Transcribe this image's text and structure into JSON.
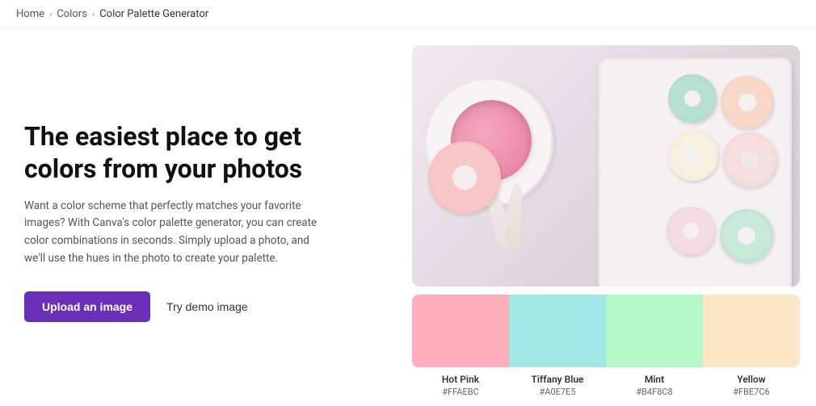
{
  "breadcrumb": {
    "home": "Home",
    "colors": "Colors",
    "current": "Color Palette Generator",
    "chevron": "›"
  },
  "hero": {
    "title": "The easiest place to get colors from your photos",
    "description": "Want a color scheme that perfectly matches your favorite images? With Canva's color palette generator, you can create color combinations in seconds. Simply upload a photo, and we'll use the hues in the photo to create your palette.",
    "upload_button": "Upload an image",
    "demo_button": "Try demo image"
  },
  "palette": {
    "colors": [
      {
        "name": "Hot Pink",
        "hex": "#FFAEBC",
        "css": "#FFAEBC"
      },
      {
        "name": "Tiffany Blue",
        "hex": "#A0E7E5",
        "css": "#A0E7E5"
      },
      {
        "name": "Mint",
        "hex": "#B4F8C8",
        "css": "#B4F8C8"
      },
      {
        "name": "Yellow",
        "hex": "#FBE7C6",
        "css": "#FBE7C6"
      }
    ]
  }
}
